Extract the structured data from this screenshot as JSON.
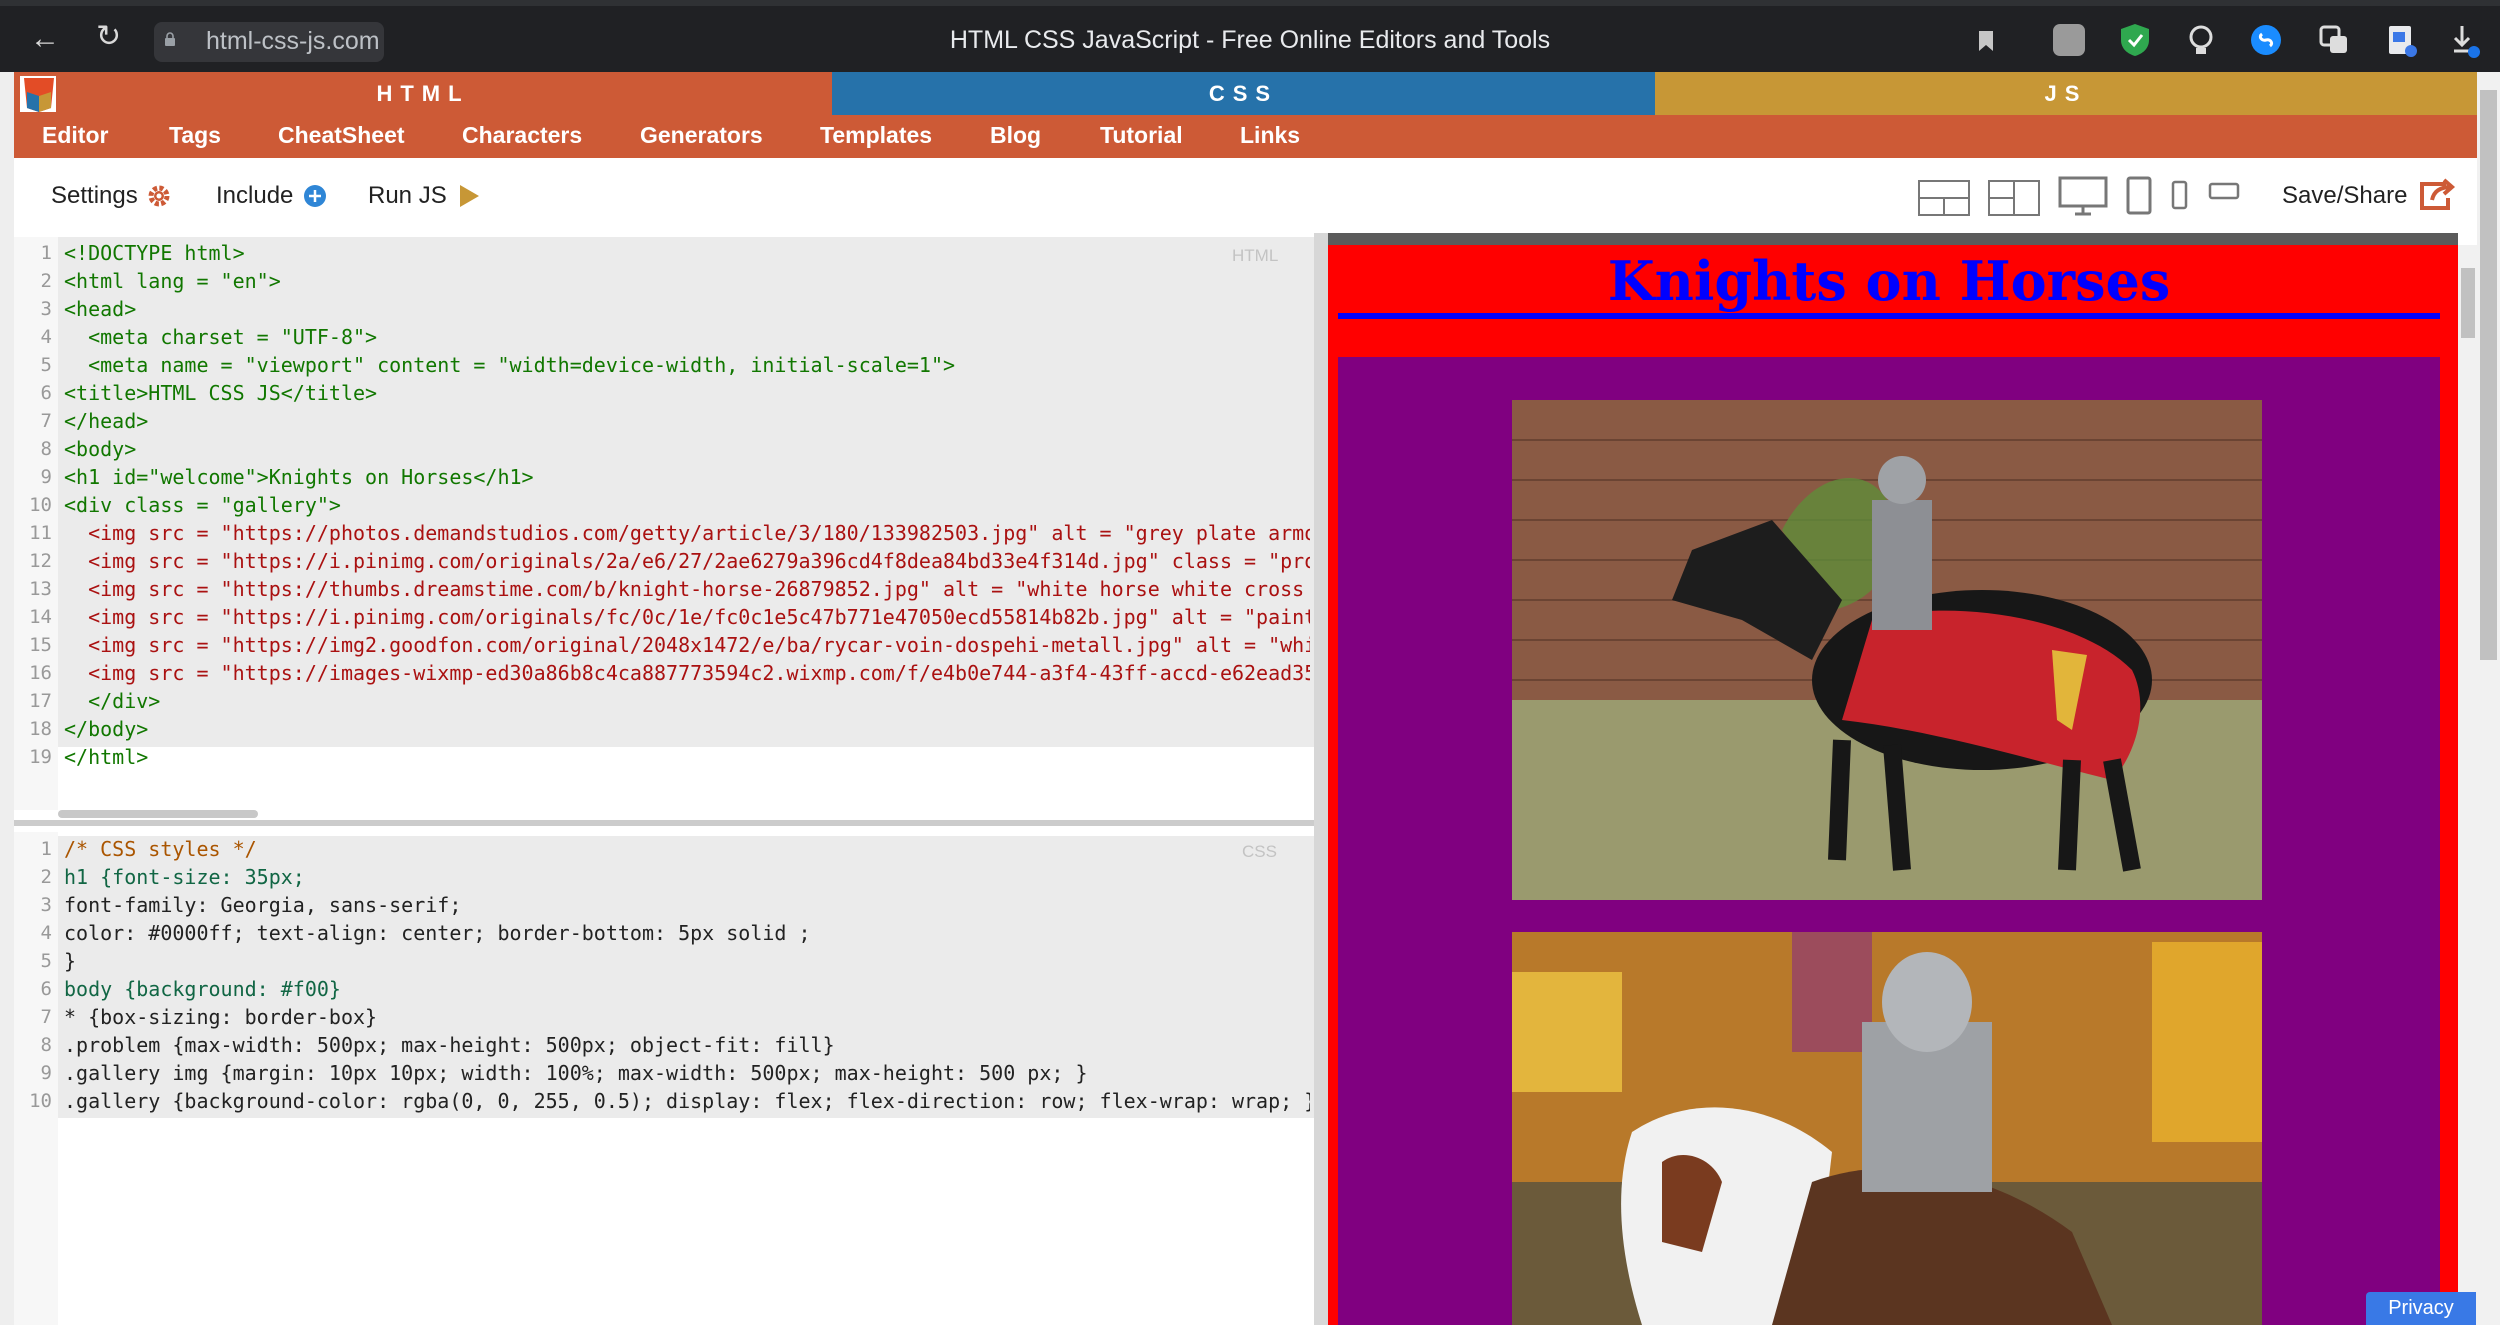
{
  "browser": {
    "url": "html-css-js.com",
    "window_title": "HTML CSS JavaScript - Free Online Editors and Tools"
  },
  "tabs": {
    "html": "HTML",
    "css": "CSS",
    "js": "JS"
  },
  "nav": [
    "Editor",
    "Tags",
    "CheatSheet",
    "Characters",
    "Generators",
    "Templates",
    "Blog",
    "Tutorial",
    "Links"
  ],
  "toolbar": {
    "settings": "Settings",
    "include": "Include",
    "run_js": "Run JS",
    "save_share": "Save/Share"
  },
  "html_editor": {
    "label": "HTML",
    "lines": [
      "<!DOCTYPE html>",
      "<html lang = \"en\">",
      "<head>",
      "  <meta charset = \"UTF-8\">",
      "  <meta name = \"viewport\" content = \"width=device-width, initial-scale=1\">",
      "<title>HTML CSS JS</title>",
      "</head>",
      "<body>",
      "<h1 id=\"welcome\">Knights on Horses</h1>",
      "<div class = \"gallery\">",
      "  <img src = \"https://photos.demandstudios.com/getty/article/3/180/133982503.jpg\" alt = \"grey plate armo",
      "  <img src = \"https://i.pinimg.com/originals/2a/e6/27/2ae6279a396cd4f8dea84bd33e4f314d.jpg\" class = \"pro",
      "  <img src = \"https://thumbs.dreamstime.com/b/knight-horse-26879852.jpg\" alt = \"white horse white cross",
      "  <img src = \"https://i.pinimg.com/originals/fc/0c/1e/fc0c1e5c47b771e47050ecd55814b82b.jpg\" alt = \"paint",
      "  <img src = \"https://img2.goodfon.com/original/2048x1472/e/ba/rycar-voin-dospehi-metall.jpg\" alt = \"whi",
      "  <img src = \"https://images-wixmp-ed30a86b8c4ca887773594c2.wixmp.com/f/e4b0e744-a3f4-43ff-accd-e62ead35",
      "  </div>",
      "</body>",
      "</html>"
    ]
  },
  "css_editor": {
    "label": "CSS",
    "lines": [
      "/* CSS styles */",
      "h1 {font-size: 35px;",
      "font-family: Georgia, sans-serif;",
      "color: #0000ff; text-align: center; border-bottom: 5px solid ;",
      "}",
      "body {background: #f00}",
      "* {box-sizing: border-box}",
      ".problem {max-width: 500px; max-height: 500px; object-fit: fill}",
      ".gallery img {margin: 10px 10px; width: 100%; max-width: 500px; max-height: 500 px; }",
      ".gallery {background-color: rgba(0, 0, 255, 0.5); display: flex; flex-direction: row; flex-wrap: wrap; }"
    ]
  },
  "preview": {
    "heading": "Knights on Horses"
  },
  "privacy": "Privacy"
}
